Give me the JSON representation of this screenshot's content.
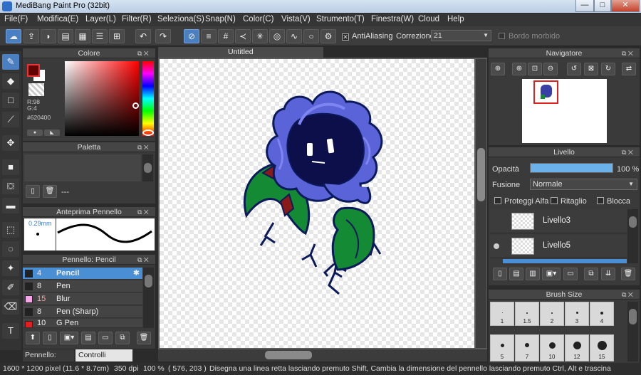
{
  "window": {
    "title": "MediBang Paint Pro (32bit)",
    "minimize": "—",
    "maximize": "□",
    "close": "✕"
  },
  "menu": [
    "File(F)",
    "Modifica(E)",
    "Layer(L)",
    "Filter(R)",
    "Seleziona(S)",
    "Snap(N)",
    "Color(C)",
    "Vista(V)",
    "Strumento(T)",
    "Finestra(W)",
    "Cloud",
    "Help"
  ],
  "toolbar": {
    "antialias_label": "AntiAliasing",
    "antialias_checked": "✕",
    "correction_label": "Correzione",
    "correction_value": "21",
    "soft_edge_label": "Bordo morbido"
  },
  "document": {
    "tab_title": "Untitled"
  },
  "color_panel": {
    "title": "Colore",
    "r": "R:98",
    "g": "G:4",
    "b": "B:",
    "hex": "#620400",
    "main_color": "#620400"
  },
  "palette_panel": {
    "title": "Paletta",
    "placeholder": "---"
  },
  "brush_preview": {
    "title": "Anteprima Pennello",
    "size": "0.29mm"
  },
  "brush_panel": {
    "title": "Pennello: Pencil",
    "items": [
      {
        "size": "4",
        "name": "Pencil",
        "color": "#222222"
      },
      {
        "size": "8",
        "name": "Pen",
        "color": "#222222"
      },
      {
        "size": "15",
        "name": "Blur",
        "color": "#f4a6e8"
      },
      {
        "size": "8",
        "name": "Pen (Sharp)",
        "color": "#222222"
      },
      {
        "size": "10",
        "name": "G Pen",
        "color": "#e02020"
      }
    ],
    "tabs": [
      "Pennello: Pencil",
      "Controlli Pennello"
    ]
  },
  "navigator": {
    "title": "Navigatore"
  },
  "layer_panel": {
    "title": "Livello",
    "opacity_label": "Opacità",
    "opacity_value": "100 %",
    "opacity_fraction": 1.0,
    "blend_label": "Fusione",
    "blend_value": "Normale",
    "protect_alpha": "Proteggi Alfa",
    "clipping": "Ritaglio",
    "lock": "Blocca",
    "layers": [
      {
        "name": "Livello3"
      },
      {
        "name": "Livello5"
      }
    ]
  },
  "brush_size_panel": {
    "title": "Brush Size",
    "sizes_row1": [
      "1",
      "1.5",
      "2",
      "3",
      "4"
    ],
    "sizes_row2": [
      "5",
      "7",
      "10",
      "12",
      "15"
    ]
  },
  "status": {
    "dimensions": "1600 * 1200 pixel",
    "physical": "(11.6 * 8.7cm)",
    "dpi": "350 dpi",
    "zoom": "100 %",
    "coords": "( 576, 203 )",
    "hint": "Disegna una linea retta lasciando premuto Shift, Cambia la dimensione del pennello lasciando premuto Ctrl, Alt e trascina"
  }
}
